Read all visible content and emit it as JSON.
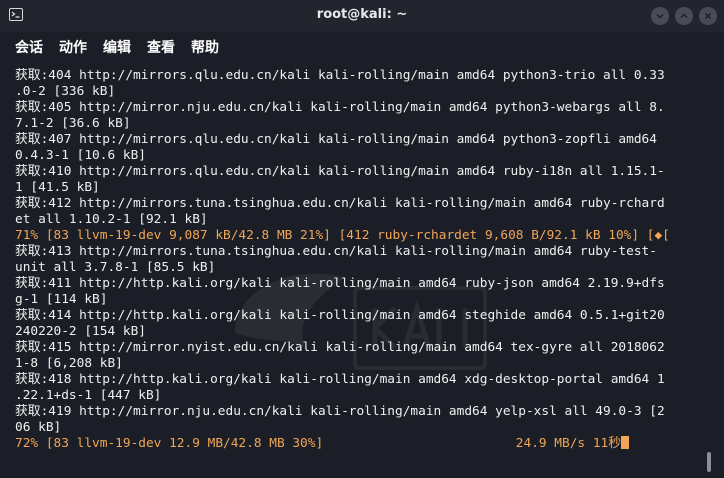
{
  "window": {
    "title": "root@kali: ~"
  },
  "menu": {
    "items": [
      "会话",
      "动作",
      "编辑",
      "查看",
      "帮助"
    ]
  },
  "terminal": {
    "lines": [
      {
        "text": "获取:404 http://mirrors.qlu.edu.cn/kali kali-rolling/main amd64 python3-trio all 0.33",
        "style": "normal"
      },
      {
        "text": ".0-2 [336 kB]",
        "style": "normal"
      },
      {
        "text": "获取:405 http://mirror.nju.edu.cn/kali kali-rolling/main amd64 python3-webargs all 8.",
        "style": "normal"
      },
      {
        "text": "7.1-2 [36.6 kB]",
        "style": "normal"
      },
      {
        "text": "获取:407 http://mirrors.qlu.edu.cn/kali kali-rolling/main amd64 python3-zopfli amd64",
        "style": "normal"
      },
      {
        "text": "0.4.3-1 [10.6 kB]",
        "style": "normal"
      },
      {
        "text": "获取:410 http://mirrors.qlu.edu.cn/kali kali-rolling/main amd64 ruby-i18n all 1.15.1-",
        "style": "normal"
      },
      {
        "text": "1 [41.5 kB]",
        "style": "normal"
      },
      {
        "text": "获取:412 http://mirrors.tuna.tsinghua.edu.cn/kali kali-rolling/main amd64 ruby-rchard",
        "style": "normal"
      },
      {
        "text": "et all 1.10.2-1 [92.1 kB]",
        "style": "normal"
      },
      {
        "text": "71% [83 llvm-19-dev 9,087 kB/42.8 MB 21%] [412 ruby-rchardet 9,608 B/92.1 kB 10%] [◆[",
        "style": "orange"
      },
      {
        "text": "获取:413 http://mirrors.tuna.tsinghua.edu.cn/kali kali-rolling/main amd64 ruby-test-",
        "style": "normal"
      },
      {
        "text": "unit all 3.7.8-1 [85.5 kB]",
        "style": "normal"
      },
      {
        "text": "获取:411 http://http.kali.org/kali kali-rolling/main amd64 ruby-json amd64 2.19.9+dfs",
        "style": "normal"
      },
      {
        "text": "g-1 [114 kB]",
        "style": "normal"
      },
      {
        "text": "获取:414 http://http.kali.org/kali kali-rolling/main amd64 steghide amd64 0.5.1+git20",
        "style": "normal"
      },
      {
        "text": "240220-2 [154 kB]",
        "style": "normal"
      },
      {
        "text": "获取:415 http://mirror.nyist.edu.cn/kali kali-rolling/main amd64 tex-gyre all 2018062",
        "style": "normal"
      },
      {
        "text": "1-8 [6,208 kB]",
        "style": "normal"
      },
      {
        "text": "获取:418 http://http.kali.org/kali kali-rolling/main amd64 xdg-desktop-portal amd64 1",
        "style": "normal"
      },
      {
        "text": ".22.1+ds-1 [447 kB]",
        "style": "normal"
      },
      {
        "text": "获取:419 http://mirror.nju.edu.cn/kali kali-rolling/main amd64 yelp-xsl all 49.0-3 [2",
        "style": "normal"
      },
      {
        "text": "06 kB]",
        "style": "normal"
      },
      {
        "text": "72% [83 llvm-19-dev 12.9 MB/42.8 MB 30%]                         24.9 MB/s 11秒",
        "style": "orange"
      }
    ]
  },
  "colors": {
    "background": "#1b1e26",
    "titlebar": "#22252e",
    "text": "#f0f0f0",
    "progress": "#f0a656"
  },
  "icons": {
    "app": "terminal-icon",
    "minimize": "minimize-icon",
    "maximize": "maximize-icon",
    "close": "close-icon"
  }
}
